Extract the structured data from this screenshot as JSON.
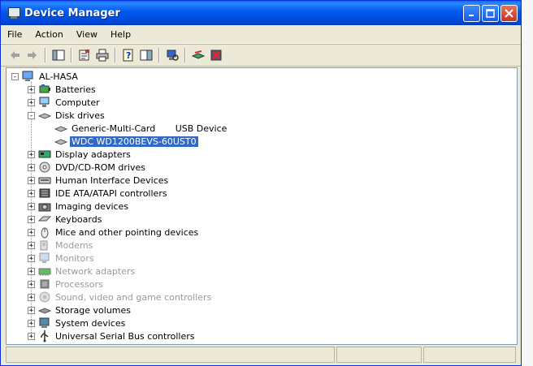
{
  "window": {
    "title": "Device Manager"
  },
  "menu": [
    "File",
    "Action",
    "View",
    "Help"
  ],
  "tree": {
    "root": "AL-HASA",
    "items": [
      {
        "label": "Batteries",
        "dim": false,
        "icon": "battery-icon"
      },
      {
        "label": "Computer",
        "dim": false,
        "icon": "computer-icon"
      },
      {
        "label": "Disk drives",
        "dim": false,
        "icon": "disk-drive-icon",
        "expanded": true,
        "children": [
          "Generic-Multi-Card       USB Device",
          "WDC WD1200BEVS-60UST0"
        ]
      },
      {
        "label": "Display adapters",
        "dim": false,
        "icon": "display-adapter-icon"
      },
      {
        "label": "DVD/CD-ROM drives",
        "dim": false,
        "icon": "cdrom-icon"
      },
      {
        "label": "Human Interface Devices",
        "dim": false,
        "icon": "hid-icon"
      },
      {
        "label": "IDE ATA/ATAPI controllers",
        "dim": false,
        "icon": "ide-controller-icon"
      },
      {
        "label": "Imaging devices",
        "dim": false,
        "icon": "camera-icon"
      },
      {
        "label": "Keyboards",
        "dim": false,
        "icon": "keyboard-icon"
      },
      {
        "label": "Mice and other pointing devices",
        "dim": false,
        "icon": "mouse-icon"
      },
      {
        "label": "Modems",
        "dim": true,
        "icon": "modem-icon"
      },
      {
        "label": "Monitors",
        "dim": true,
        "icon": "monitor-icon"
      },
      {
        "label": "Network adapters",
        "dim": true,
        "icon": "network-adapter-icon"
      },
      {
        "label": "Processors",
        "dim": true,
        "icon": "processor-icon"
      },
      {
        "label": "Sound, video and game controllers",
        "dim": true,
        "icon": "sound-icon"
      },
      {
        "label": "Storage volumes",
        "dim": false,
        "icon": "storage-volume-icon"
      },
      {
        "label": "System devices",
        "dim": false,
        "icon": "system-device-icon"
      },
      {
        "label": "Universal Serial Bus controllers",
        "dim": false,
        "icon": "usb-icon"
      }
    ]
  },
  "colors": {
    "titlebar": "#0054e3",
    "selection": "#316ac5"
  }
}
